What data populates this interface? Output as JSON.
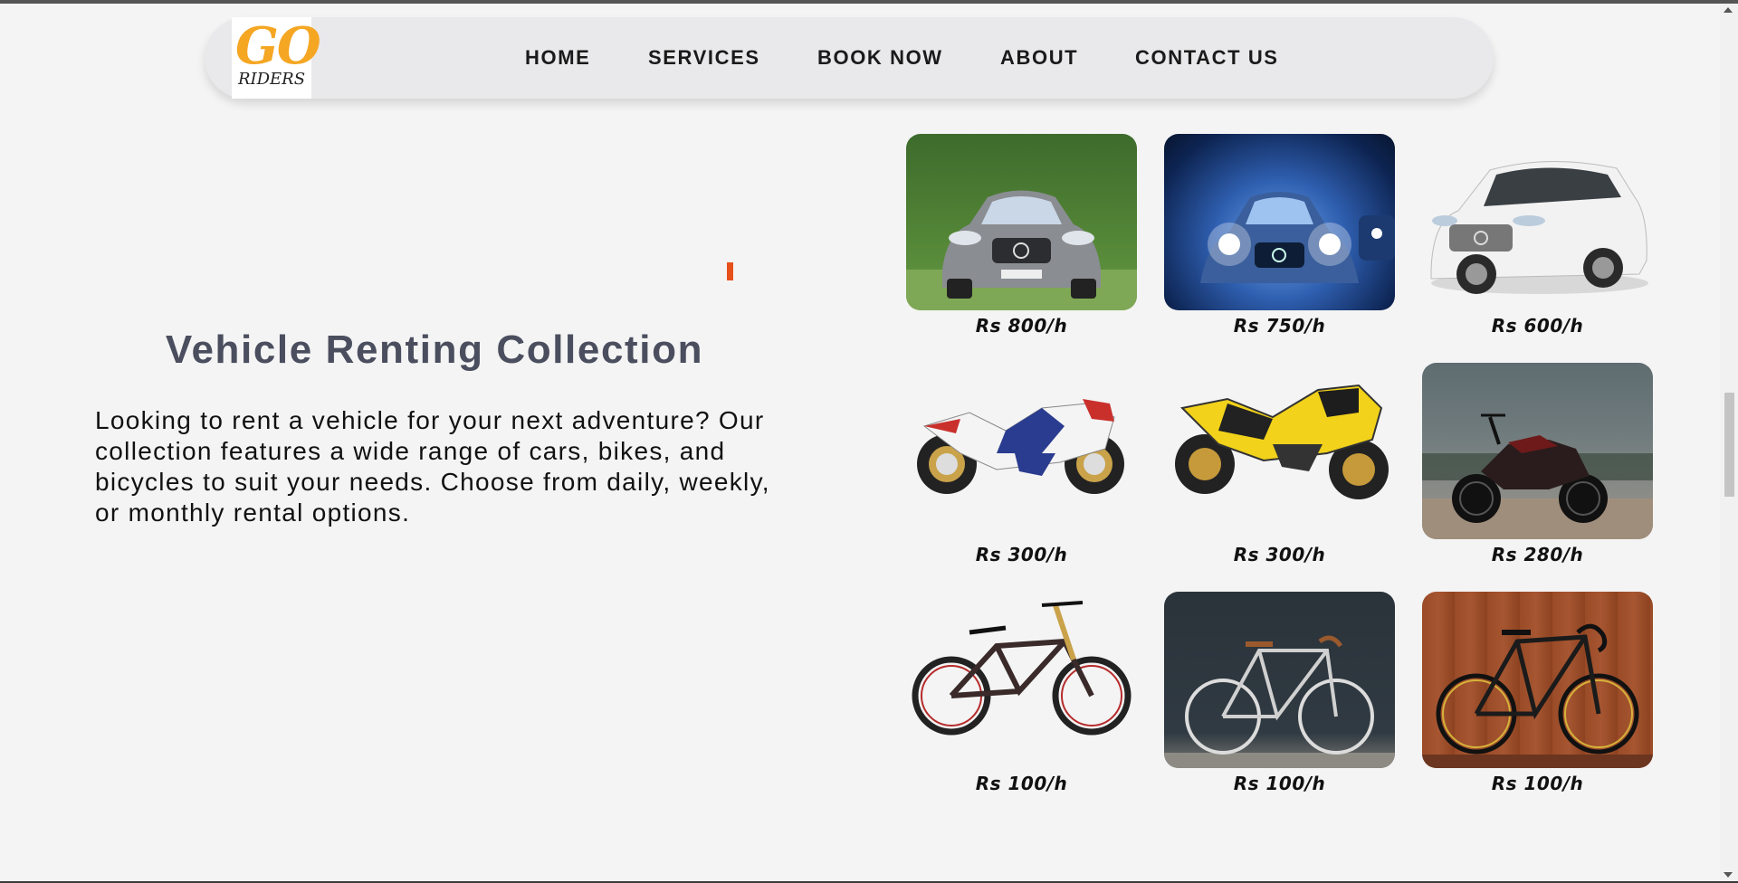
{
  "header": {
    "logo": {
      "top": "GO",
      "bottom": "RIDERS"
    },
    "nav": [
      {
        "label": "HOME"
      },
      {
        "label": "SERVICES"
      },
      {
        "label": "BOOK NOW"
      },
      {
        "label": "ABOUT"
      },
      {
        "label": "CONTACT US"
      }
    ]
  },
  "main": {
    "title": "Vehicle Renting Collection",
    "description": "Looking to rent a vehicle for your next adventure? Our collection features a wide range of cars, bikes, and bicycles to suit your needs. Choose from daily, weekly, or monthly rental options."
  },
  "vehicles": [
    {
      "kind": "car",
      "price": "Rs 800/h"
    },
    {
      "kind": "car",
      "price": "Rs 750/h"
    },
    {
      "kind": "car",
      "price": "Rs 600/h"
    },
    {
      "kind": "bike",
      "price": "Rs 300/h"
    },
    {
      "kind": "bike",
      "price": "Rs 300/h"
    },
    {
      "kind": "bike",
      "price": "Rs 280/h"
    },
    {
      "kind": "bicycle",
      "price": "Rs 100/h"
    },
    {
      "kind": "bicycle",
      "price": "Rs 100/h"
    },
    {
      "kind": "bicycle",
      "price": "Rs 100/h"
    }
  ],
  "colors": {
    "logo_orange": "#f5a623",
    "accent": "#e8501a",
    "heading": "#4a4e5e",
    "navbar_bg": "#e9e9eb",
    "page_bg": "#f4f4f4"
  }
}
